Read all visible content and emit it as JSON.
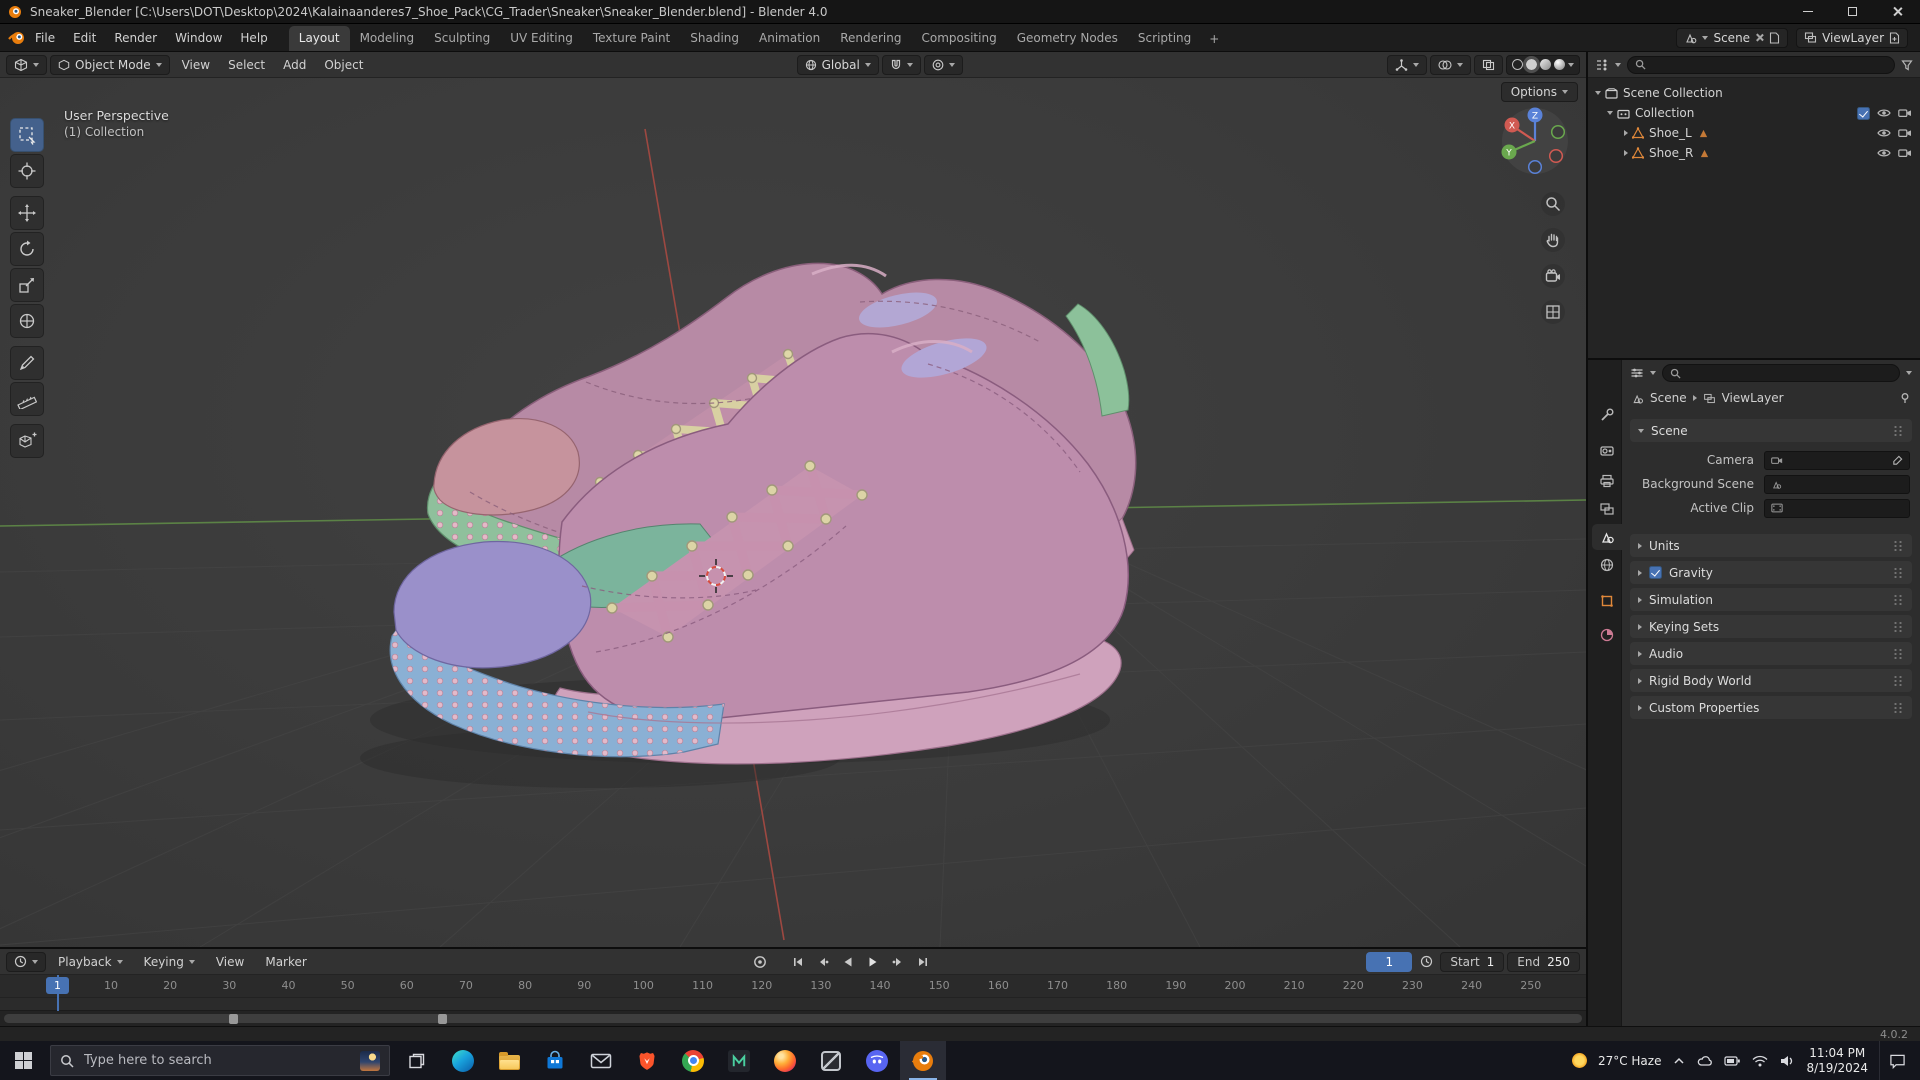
{
  "window": {
    "title": "Sneaker_Blender [C:\\Users\\DOT\\Desktop\\2024\\Kalainaanderes7_Shoe_Pack\\CG_Trader\\Sneaker\\Sneaker_Blender.blend] - Blender 4.0"
  },
  "topbar": {
    "menus": [
      "File",
      "Edit",
      "Render",
      "Window",
      "Help"
    ],
    "workspaces": [
      "Layout",
      "Modeling",
      "Sculpting",
      "UV Editing",
      "Texture Paint",
      "Shading",
      "Animation",
      "Rendering",
      "Compositing",
      "Geometry Nodes",
      "Scripting"
    ],
    "new_workspace": "+",
    "scene_name": "Scene",
    "view_layer_name": "ViewLayer"
  },
  "viewport": {
    "mode": "Object Mode",
    "menus": [
      "View",
      "Select",
      "Add",
      "Object"
    ],
    "orientation": "Global",
    "options_label": "Options",
    "overlay_line1": "User Perspective",
    "overlay_line2": "(1) Collection",
    "gizmo": {
      "x": "X",
      "y": "Y",
      "z": "Z"
    }
  },
  "outliner": {
    "rows": [
      {
        "label": "Scene Collection",
        "icon": "scene-collection-icon"
      },
      {
        "label": "Collection",
        "icon": "collection-icon"
      },
      {
        "label": "Shoe_L",
        "icon": "mesh-object-icon"
      },
      {
        "label": "Shoe_R",
        "icon": "mesh-object-icon"
      }
    ]
  },
  "properties": {
    "breadcrumb_scene": "Scene",
    "breadcrumb_layer": "ViewLayer",
    "scene_panel_title": "Scene",
    "fields": [
      {
        "label": "Camera",
        "icon": "camera-icon"
      },
      {
        "label": "Background Scene",
        "icon": "scene-icon"
      },
      {
        "label": "Active Clip",
        "icon": "movie-clip-icon"
      }
    ],
    "panels": [
      {
        "label": "Units"
      },
      {
        "label": "Gravity",
        "checked": true
      },
      {
        "label": "Simulation"
      },
      {
        "label": "Keying Sets"
      },
      {
        "label": "Audio"
      },
      {
        "label": "Rigid Body World"
      },
      {
        "label": "Custom Properties"
      }
    ]
  },
  "timeline": {
    "menus": [
      "Playback",
      "Keying",
      "View",
      "Marker"
    ],
    "current_frame": "1",
    "playhead_frame": "1",
    "start_label": "Start",
    "start_value": "1",
    "end_label": "End",
    "end_value": "250",
    "ruler": [
      "10",
      "20",
      "30",
      "40",
      "50",
      "60",
      "70",
      "80",
      "90",
      "100",
      "110",
      "120",
      "130",
      "140",
      "150",
      "160",
      "170",
      "180",
      "190",
      "200",
      "210",
      "220",
      "230",
      "240",
      "250"
    ]
  },
  "statusbar": {
    "version": "4.0.2"
  },
  "taskbar": {
    "search_placeholder": "Type here to search",
    "weather": "27°C Haze",
    "time": "11:04 PM",
    "date": "8/19/2024",
    "app_icons": [
      "windows-start",
      "task-view",
      "edge",
      "file-explorer",
      "microsoft-store",
      "mail",
      "brave",
      "chrome",
      "m-app",
      "firefox",
      "unknown-app",
      "discord",
      "blender"
    ],
    "tray_icons": [
      "weather",
      "hidden-icons-chevron",
      "cloud",
      "battery",
      "wifi",
      "volume",
      "notification-center"
    ]
  },
  "colors": {
    "accent": "#4772b3",
    "blender_orange": "#e87d0d",
    "axis_x_red": "#a84a42",
    "axis_y_green": "#5f8a47",
    "shoe_body_mauve": "#bd8dac",
    "shoe_sole_green": "#8fc09c",
    "shoe_sole_blue": "#8ab0d4",
    "shoe_toe_purple": "#9a90ca",
    "shoe_lace_cream": "#d8d0a2"
  }
}
